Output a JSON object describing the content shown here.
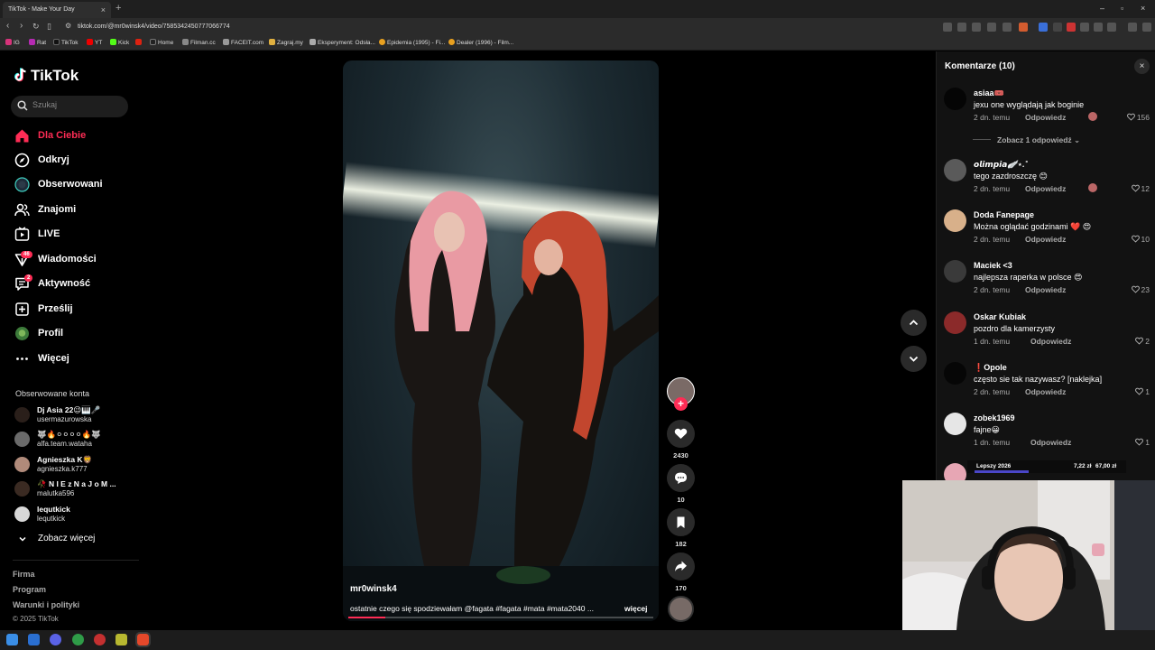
{
  "browser": {
    "tab_title": "TikTok - Make Your Day",
    "url": "tiktok.com/@mr0winsk4/video/7585342450777066774",
    "bookmarks": [
      "IG",
      "Rat",
      "TikTok",
      "YT",
      "Kick",
      "Home",
      "Filman.cc",
      "FACEIT.com",
      "Zagraj.my",
      "Eksperyment: Odsła...",
      "Epidemia (1995) - Fi...",
      "Dealer (1996) - Film..."
    ]
  },
  "sidebar": {
    "logo": "TikTok",
    "search_placeholder": "Szukaj",
    "nav": [
      {
        "label": "Dla Ciebie",
        "icon": "home-icon",
        "active": true
      },
      {
        "label": "Odkryj",
        "icon": "compass-icon"
      },
      {
        "label": "Obserwowani",
        "icon": "following-avatar-icon"
      },
      {
        "label": "Znajomi",
        "icon": "friends-icon"
      },
      {
        "label": "LIVE",
        "icon": "live-icon"
      },
      {
        "label": "Wiadomości",
        "icon": "messages-icon",
        "badge": "46"
      },
      {
        "label": "Aktywność",
        "icon": "activity-icon",
        "badge": "2"
      },
      {
        "label": "Prześlij",
        "icon": "upload-icon"
      },
      {
        "label": "Profil",
        "icon": "profile-icon"
      },
      {
        "label": "Więcej",
        "icon": "more-icon"
      }
    ],
    "following_title": "Obserwowane konta",
    "following": [
      {
        "name": "Dj Asia 22😉🎹🎤",
        "user": "usermazurowska"
      },
      {
        "name": "🐺🔥⚪⚪⚪⚪🔥🐺",
        "user": "alfa.team.wataha"
      },
      {
        "name": "Agnieszka K🦁",
        "user": "agnieszka.k777"
      },
      {
        "name": "🥀 N I E z N a J o M ...",
        "user": "malutka596"
      },
      {
        "name": "lequtkick",
        "user": "lequtkick"
      }
    ],
    "see_more": "Zobacz więcej",
    "footer": [
      "Firma",
      "Program",
      "Warunki i polityki",
      "© 2025 TikTok"
    ]
  },
  "video": {
    "author": "mr0winsk4",
    "caption": "ostatnie czego się spodziewałam @fagata #fagata #mata #mata2040 ...",
    "more": "więcej",
    "progress": 0.12
  },
  "actions": {
    "likes": "2430",
    "comments": "10",
    "saves": "182",
    "shares": "170"
  },
  "comments_panel": {
    "title": "Komentarze (10)",
    "replies_label": "Zobacz 1 odpowiedź",
    "reply_label": "Odpowiedz",
    "items": [
      {
        "name": "asiaa🎟️",
        "text": "jexu one wyglądają jak boginie",
        "date": "2 dn. temu",
        "likes": "156",
        "by_creator": true
      },
      {
        "name": "𝙤𝙡𝙞𝙢𝙥𝙞𝙖🪽⋆.˚",
        "text": "tego zazdroszczę 😊",
        "date": "2 dn. temu",
        "likes": "12",
        "by_creator": true
      },
      {
        "name": "Doda Fanepage",
        "text": "Można oglądać godzinami ❤️ 😍",
        "date": "2 dn. temu",
        "likes": "10"
      },
      {
        "name": "Maciek <3",
        "text": "najlepsza raperka w polsce 😍",
        "date": "2 dn. temu",
        "likes": "23"
      },
      {
        "name": "Oskar Kubiak",
        "text": "pozdro dla kamerzysty",
        "date": "1 dn. temu",
        "likes": "2"
      },
      {
        "name": "❗Opole",
        "text": "często sie tak nazywasz? [naklejka]",
        "date": "2 dn. temu",
        "likes": "1"
      },
      {
        "name": "zobek1969",
        "text": "fajne😀",
        "date": "1 dn. temu",
        "likes": "1"
      }
    ]
  },
  "overlay": {
    "label": "Lepszy 2026",
    "amount_1": "7,22 zł",
    "amount_2": "67,00 zł"
  }
}
